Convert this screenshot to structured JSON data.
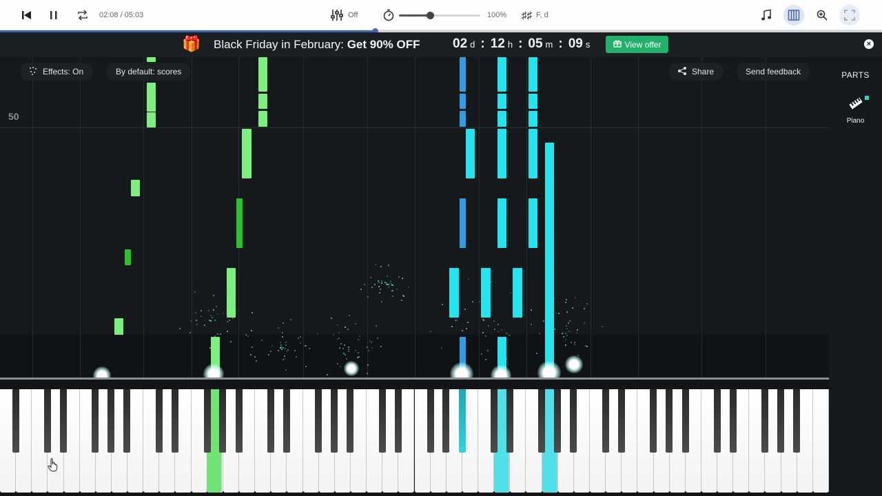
{
  "toolbar": {
    "time_current": "02:08",
    "time_total": "05:03",
    "time_display": "02:08 / 05:03",
    "mixer_label": "Off",
    "speed_label": "100%",
    "speed_value": 1.0,
    "key_label": "F, d",
    "progress_fraction": 0.425
  },
  "banner": {
    "promo_prefix": "Black Friday in February: ",
    "promo_bold": "Get 90% OFF",
    "countdown": {
      "days": "02",
      "days_unit": "d",
      "hours": "12",
      "hours_unit": "h",
      "minutes": "05",
      "minutes_unit": "m",
      "seconds": "09",
      "seconds_unit": "s"
    },
    "offer_button": "View offer"
  },
  "roll": {
    "effects_label": "Effects: On",
    "default_label": "By default: scores",
    "share_label": "Share",
    "feedback_label": "Send feedback",
    "measure_number": "50"
  },
  "parts": {
    "title": "PARTS",
    "items": [
      {
        "label": "Piano"
      }
    ]
  },
  "colors": {
    "accent": "#3e64b6",
    "offer_green": "#22b06b",
    "note_green": "#6fe373",
    "note_dark_green": "#2bc22a",
    "note_cyan": "#22e0ea",
    "note_blue": "#2a9ee6"
  }
}
